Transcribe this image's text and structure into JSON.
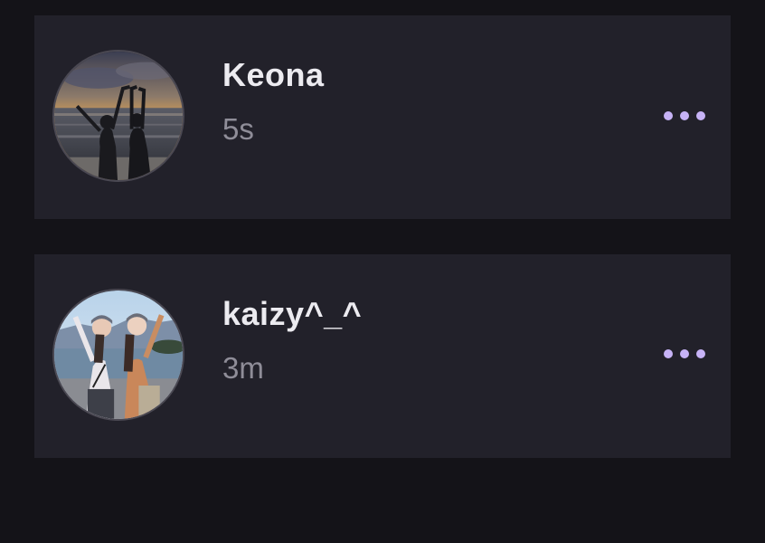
{
  "posts": [
    {
      "username": "Keona",
      "timestamp": "5s",
      "avatar_icon": "sunset-beach-photo",
      "more_icon": "more-horizontal-icon"
    },
    {
      "username": "kaizy^_^",
      "timestamp": "3m",
      "avatar_icon": "beach-friends-photo",
      "more_icon": "more-horizontal-icon"
    }
  ],
  "colors": {
    "background": "#141318",
    "card": "#22212a",
    "username": "#ecebf0",
    "timestamp": "#8f8d98",
    "accent": "#c7b3f6"
  }
}
